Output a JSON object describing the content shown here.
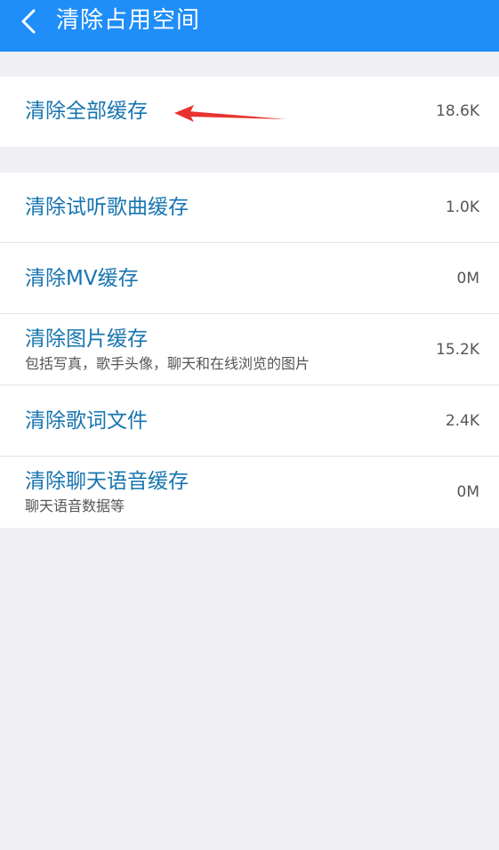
{
  "header": {
    "title": "清除占用空间",
    "back_icon": "chevron-left-icon",
    "background": "#1f8ef8"
  },
  "top_group": {
    "items": [
      {
        "label": "清除全部缓存",
        "size": "18.6K"
      }
    ]
  },
  "list_group": {
    "items": [
      {
        "label": "清除试听歌曲缓存",
        "size": "1.0K"
      },
      {
        "label": "清除MV缓存",
        "size": "0M"
      },
      {
        "label": "清除图片缓存",
        "subtitle": "包括写真，歌手头像，聊天和在线浏览的图片",
        "size": "15.2K"
      },
      {
        "label": "清除歌词文件",
        "size": "2.4K"
      },
      {
        "label": "清除聊天语音缓存",
        "subtitle": "聊天语音数据等",
        "size": "0M"
      }
    ]
  },
  "colors": {
    "accent": "#1f8ef8",
    "label": "#1775b0",
    "page_background": "#efeff4",
    "annotation_arrow": "#e8322f"
  }
}
